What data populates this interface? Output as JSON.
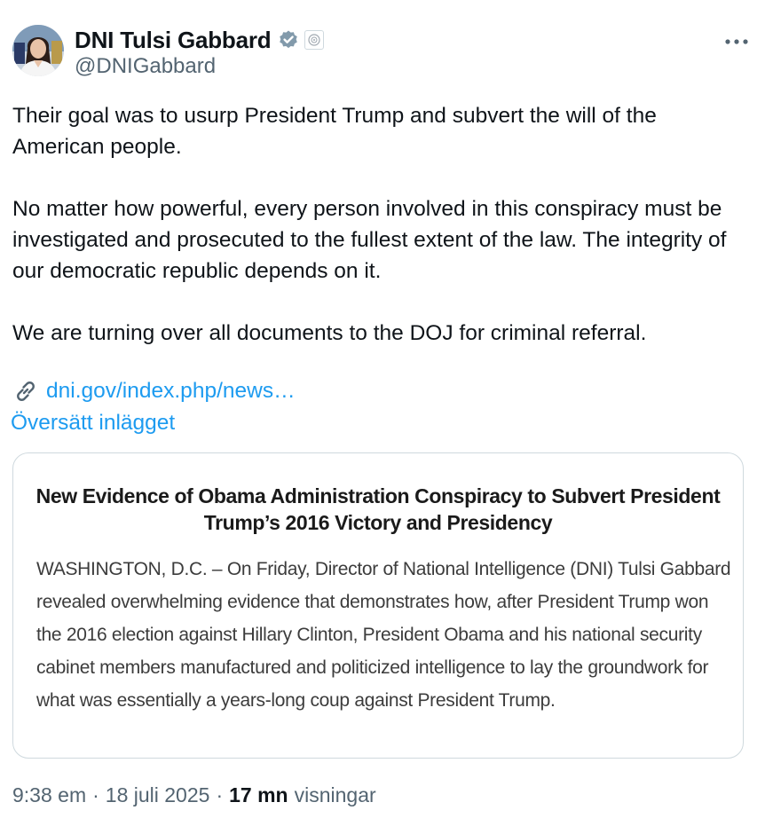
{
  "author": {
    "display_name": "DNI Tulsi Gabbard",
    "handle": "@DNIGabbard",
    "verified_color": "#829aab"
  },
  "tweet": {
    "paragraphs": [
      "Their goal was to usurp President Trump and subvert the will of the American people.",
      "No matter how powerful, every person involved in this conspiracy must be investigated and prosecuted to the fullest extent of the law. The integrity of our democratic republic depends on it.",
      "We are turning over all documents to the DOJ for criminal referral."
    ],
    "link_text": "dni.gov/index.php/news…",
    "translate_label": "Översätt inlägget"
  },
  "card": {
    "title": "New Evidence of Obama Administration Conspiracy to Subvert President Trump’s 2016 Victory and Presidency",
    "body": "WASHINGTON, D.C. – On Friday, Director of National Intelligence (DNI) Tulsi Gabbard revealed overwhelming evidence that demonstrates how, after President Trump won the 2016 election against Hillary Clinton, President Obama and his national security cabinet members manufactured and politicized intelligence to lay the groundwork for what was essentially a years-long coup against President Trump."
  },
  "footer": {
    "time": "9:38 em",
    "separator": "·",
    "date": "18 juli 2025",
    "views_count": "17 mn",
    "views_label": "visningar"
  },
  "colors": {
    "link": "#1d9bf0",
    "secondary_text": "#536471",
    "border": "#cfd9de"
  }
}
